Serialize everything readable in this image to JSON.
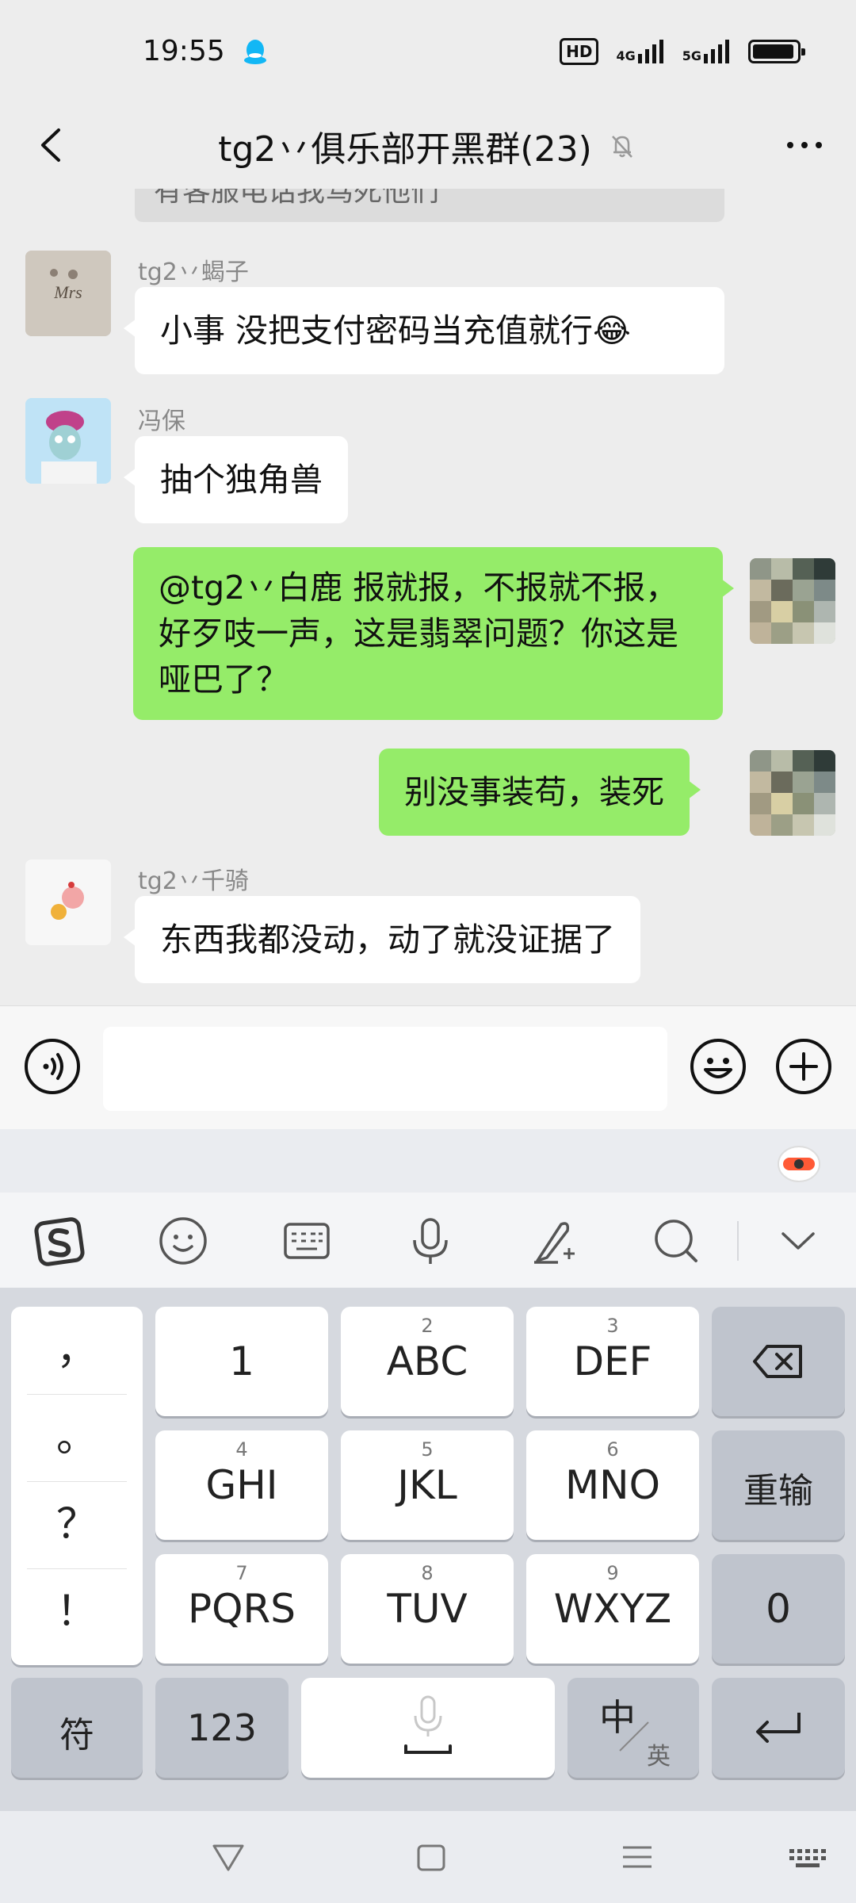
{
  "status_bar": {
    "time": "19:55",
    "hd_label": "HD",
    "signal_4g": "4G",
    "signal_5g": "5G",
    "battery_percent": 95
  },
  "header": {
    "title": "tg2丷俱乐部开黑群(23)"
  },
  "chat": {
    "previous_partial": "有客服电话我骂死他们",
    "messages": [
      {
        "direction": "in",
        "sender": "tg2丷蝎子",
        "text": "小事  没把支付密码当充值就行😂"
      },
      {
        "direction": "in",
        "sender": "冯保",
        "text": "抽个独角兽"
      },
      {
        "direction": "out",
        "text": "@tg2丷白鹿  报就报，不报就不报，好歹吱一声，这是翡翠问题？你这是哑巴了？"
      },
      {
        "direction": "out",
        "text": "别没事装苟，装死"
      },
      {
        "direction": "in",
        "sender": "tg2丷千骑",
        "text": "东西我都没动，动了就没证据了"
      }
    ]
  },
  "input_bar": {
    "value": ""
  },
  "keyboard": {
    "punctuation": [
      "，",
      "。",
      "？",
      "！"
    ],
    "rows": [
      [
        {
          "sub": "",
          "main": "1"
        },
        {
          "sub": "2",
          "main": "ABC"
        },
        {
          "sub": "3",
          "main": "DEF"
        }
      ],
      [
        {
          "sub": "4",
          "main": "GHI"
        },
        {
          "sub": "5",
          "main": "JKL"
        },
        {
          "sub": "6",
          "main": "MNO"
        }
      ],
      [
        {
          "sub": "7",
          "main": "PQRS"
        },
        {
          "sub": "8",
          "main": "TUV"
        },
        {
          "sub": "9",
          "main": "WXYZ"
        }
      ]
    ],
    "reenter_label": "重输",
    "zero_label": "0",
    "symbol_label": "符",
    "num_label": "123",
    "lang_main": "中",
    "lang_sub": "英"
  },
  "colors": {
    "outgoing_bubble": "#95ec69",
    "incoming_bubble": "#ffffff",
    "chat_background": "#ededed",
    "qq_blue": "#12b7f5"
  },
  "icons": [
    "qq-icon",
    "back-icon",
    "mute-bell-icon",
    "more-icon",
    "voice-icon",
    "emoji-icon",
    "plus-icon",
    "sogou-logo-icon",
    "smiley-icon",
    "keyboard-icon",
    "mic-icon",
    "handwriting-icon",
    "search-icon",
    "chevron-down-icon",
    "backspace-icon",
    "enter-icon",
    "nav-back-icon",
    "nav-home-icon",
    "nav-menu-icon",
    "nav-keyboard-icon"
  ]
}
